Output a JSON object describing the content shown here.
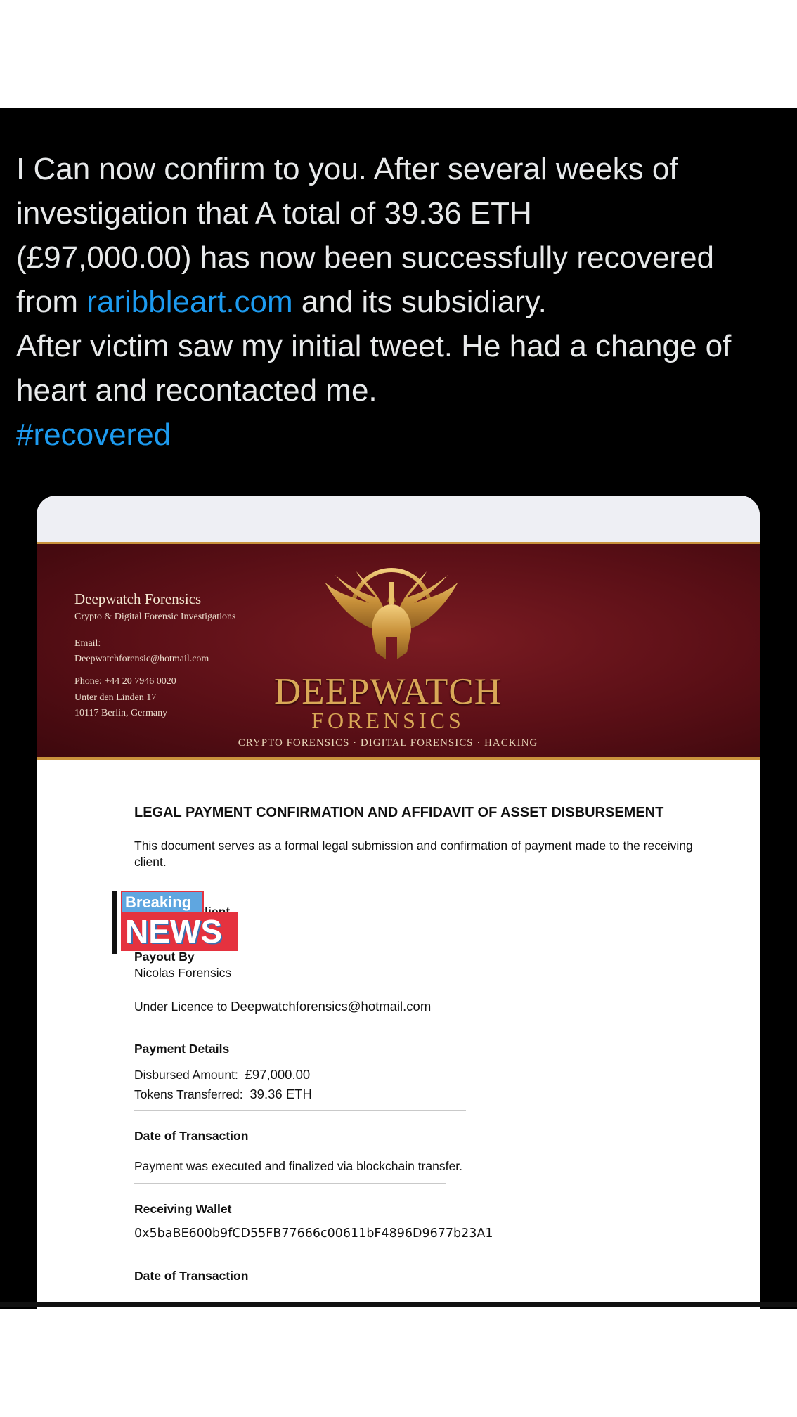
{
  "tweet": {
    "lines": [
      "I Can now confirm to you. After several weeks of",
      "investigation that A total of 39.36 ETH",
      "(£97,000.00) has now been successfully recovered"
    ],
    "line4_before": "from ",
    "line4_link": "raribbleart.com",
    "line4_after": " and its subsidiary.",
    "line5": "After victim saw my initial tweet. He had a change of",
    "line6": "heart and recontacted me.",
    "hashtag": "#recovered",
    "link_color": "#1d9bf0"
  },
  "letterhead": {
    "name": "Deepwatch Forensics",
    "subtitle": "Crypto & Digital Forensic Investigations",
    "email_label": "Email:",
    "email": "Deepwatchforensic@hotmail.com",
    "phone": "Phone: +44 20 7946 0020",
    "address1": "Unter den Linden 17",
    "address2": "10117 Berlin, Germany",
    "brand_line1": "DEEPWATCH",
    "brand_line2": "FORENSICS",
    "tagline": "CRYPTO FORENSICS · DIGITAL FORENSICS · HACKING",
    "emblem_icon": "winged-spartan-helmet-icon"
  },
  "document": {
    "title": "LEGAL PAYMENT CONFIRMATION AND AFFIDAVIT OF ASSET DISBURSEMENT",
    "intro": "This document serves as a formal legal submission and confirmation of payment made to the receiving client.",
    "receiving_client_label": "Receiving Client",
    "payout_label": "Payout By",
    "payout_value": "Nicolas Forensics",
    "licence_prefix": "Under Licence to ",
    "licence_email": "Deepwatchforensics@hotmail.com",
    "payment_details_label": "Payment Details",
    "disbursed_label": "Disbursed Amount:",
    "disbursed_value": "£97,000.00",
    "tokens_label": "Tokens Transferred:",
    "tokens_value": "39.36 ETH",
    "date_label": "Date of Transaction",
    "date_text": "Payment was executed and finalized via blockchain transfer.",
    "wallet_label": "Receiving Wallet",
    "wallet_value": "0x5baBE600b9fCD55FB77666c00611bF4896D9677b23A1",
    "date_label_2": "Date of Transaction"
  },
  "overlay": {
    "breaking": "Breaking",
    "news": "NEWS"
  }
}
